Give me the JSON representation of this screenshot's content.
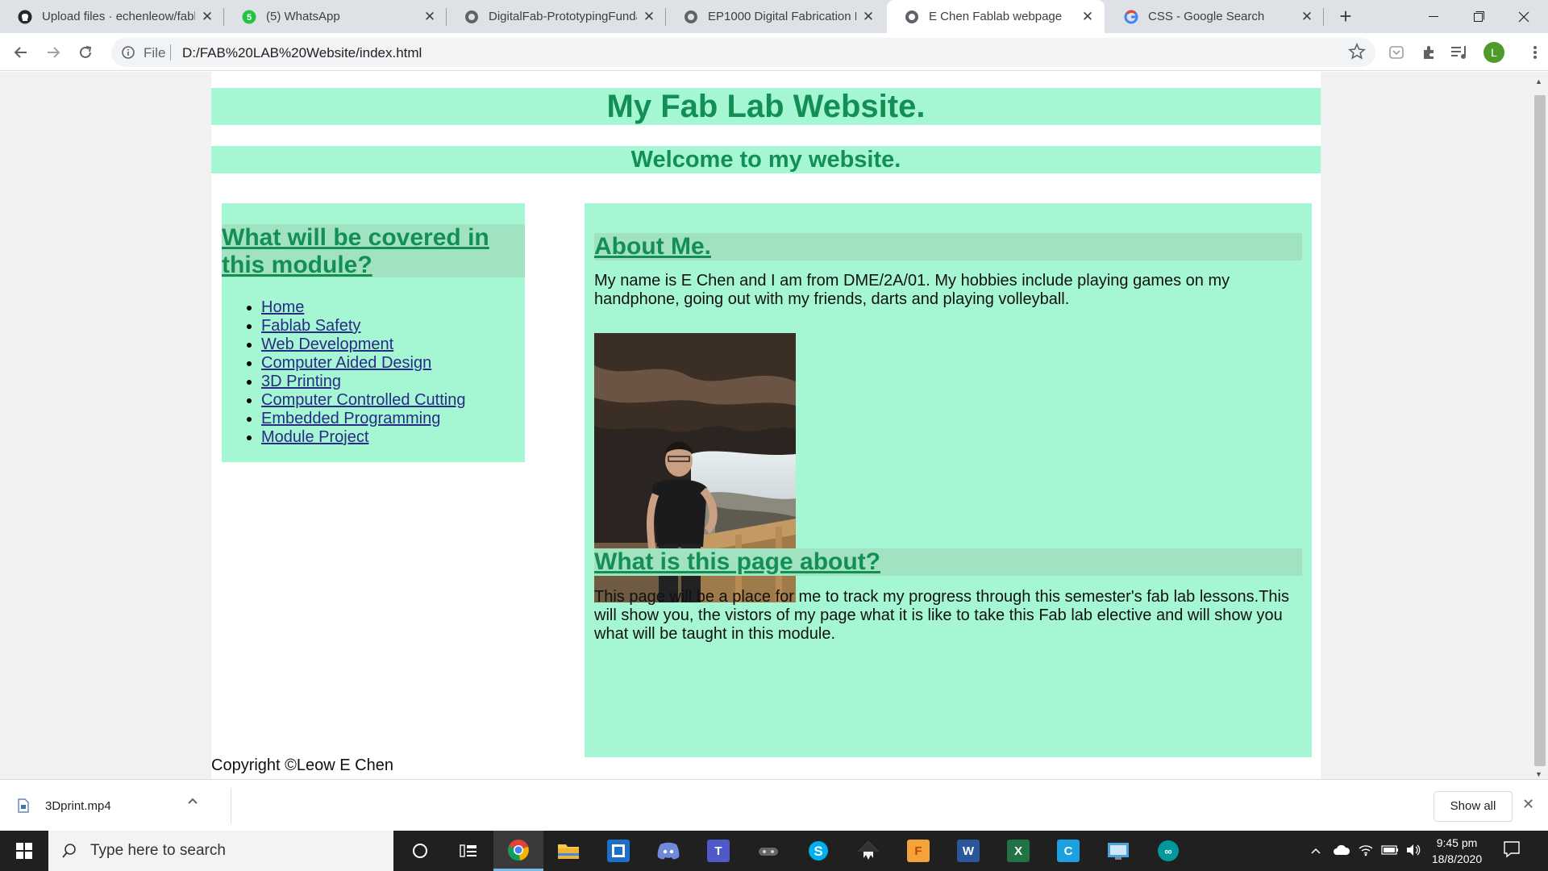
{
  "browser": {
    "tabs": [
      {
        "title": "Upload files · echenleow/fabl",
        "icon": "github-icon"
      },
      {
        "title": "(5) WhatsApp",
        "icon": "whatsapp-icon"
      },
      {
        "title": "DigitalFab-PrototypingFunda",
        "icon": "globe-icon"
      },
      {
        "title": "EP1000 Digital Fabrication Pr",
        "icon": "globe-icon"
      },
      {
        "title": "E Chen Fablab webpage",
        "icon": "globe-icon"
      },
      {
        "title": "CSS - Google Search",
        "icon": "google-icon"
      }
    ],
    "active_tab": 4,
    "address": {
      "scheme_label": "File",
      "url": "D:/FAB%20LAB%20Website/index.html"
    },
    "profile_initial": "L"
  },
  "page": {
    "title": "My Fab Lab Website.",
    "subtitle": "Welcome to my website.",
    "sidebar": {
      "heading_line1": "What will be covered in",
      "heading_line2": "this module?",
      "links": [
        "Home",
        "Fablab Safety",
        "Web Development",
        "Computer Aided Design",
        "3D Printing",
        "Computer Controlled Cutting",
        "Embedded Programming",
        "Module Project"
      ]
    },
    "about": {
      "heading": "About Me.",
      "text": "My name is E Chen and I am from DME/2A/01. My hobbies include playing games on my handphone, going out with my friends, darts and playing volleyball."
    },
    "page_about": {
      "heading": "What is this page about?",
      "text": "This page will be a place for me to track my progress through this semester's fab lab lessons.This will show you, the vistors of my page what it is like to take this Fab lab elective and will show you what will be taught in this module."
    },
    "copyright": "Copyright ©Leow E Chen"
  },
  "downloads": {
    "file": "3Dprint.mp4",
    "show_all": "Show all"
  },
  "taskbar": {
    "search_placeholder": "Type here to search",
    "time": "9:45 pm",
    "date": "18/8/2020"
  },
  "colors": {
    "banner_bg": "#a5f7d3",
    "heading_bg": "#a1e3c1",
    "heading_text": "#138f56",
    "link": "#2a2a87"
  }
}
